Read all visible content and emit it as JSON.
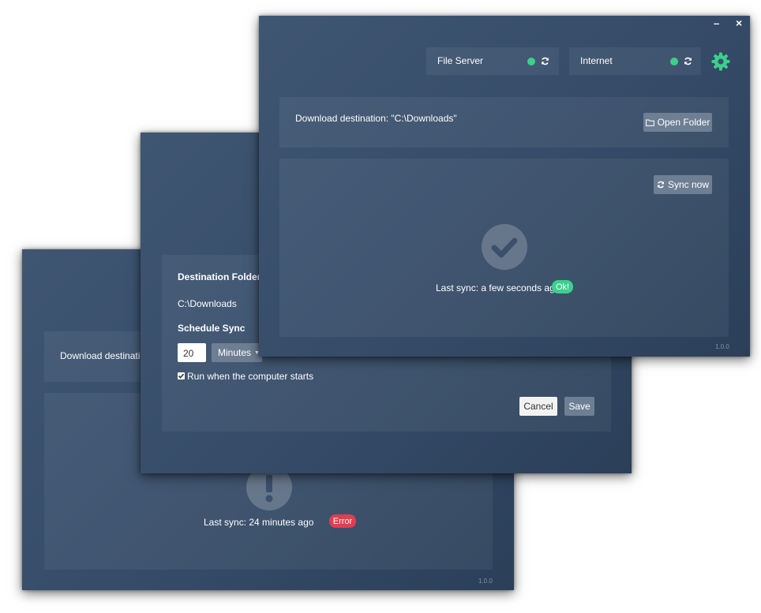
{
  "colors": {
    "window_bg": "#3a506c",
    "ok": "#3ccf8e",
    "error": "#e03e52",
    "button": "#6e7f94",
    "gear": "#3ccf8e"
  },
  "back_window": {
    "download_label": "Download destination",
    "last_sync": "Last sync: 24 minutes ago",
    "status_badge": "Error",
    "version": "1.0.0"
  },
  "settings_window": {
    "destination_heading": "Destination Folder",
    "destination_value": "C:\\Downloads",
    "schedule_heading": "Schedule Sync",
    "interval_value": "20",
    "interval_unit": "Minutes",
    "run_on_startup_label": "Run when the computer starts",
    "run_on_startup_checked": true,
    "cancel_label": "Cancel",
    "save_label": "Save"
  },
  "main_window": {
    "minimize_symbol": "–",
    "close_symbol": "×",
    "status_items": [
      {
        "label": "File Server",
        "state": "online"
      },
      {
        "label": "Internet",
        "state": "online"
      }
    ],
    "download_destination": "Download destination: \"C:\\Downloads\"",
    "open_folder_label": "Open Folder",
    "sync_now_label": "Sync now",
    "last_sync": "Last sync: a few seconds ago",
    "status_badge": "Ok!",
    "version": "1.0.0"
  }
}
